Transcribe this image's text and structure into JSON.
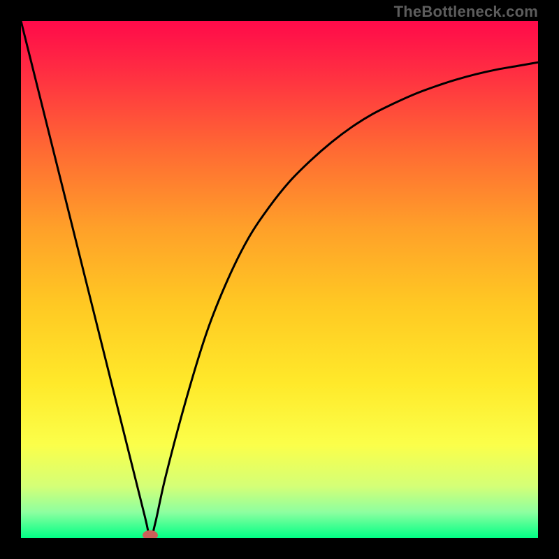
{
  "watermark": "TheBottleneck.com",
  "chart_data": {
    "type": "line",
    "title": "",
    "xlabel": "",
    "ylabel": "",
    "xlim": [
      0,
      100
    ],
    "ylim": [
      0,
      100
    ],
    "grid": false,
    "legend": false,
    "series": [
      {
        "name": "bottleneck-curve",
        "x": [
          0,
          4,
          8,
          12,
          16,
          20,
          24,
          25,
          26,
          28,
          32,
          36,
          40,
          44,
          48,
          52,
          56,
          60,
          64,
          68,
          72,
          76,
          80,
          84,
          88,
          92,
          96,
          100
        ],
        "y": [
          100,
          84,
          68,
          52,
          36,
          20,
          4,
          0,
          3,
          12,
          27,
          40,
          50,
          58,
          64,
          69,
          73,
          76.5,
          79.5,
          82,
          84,
          85.8,
          87.3,
          88.6,
          89.7,
          90.6,
          91.3,
          92
        ]
      }
    ],
    "marker": {
      "x": 25,
      "y": 0,
      "color": "#cb5f59"
    },
    "background_gradient": {
      "stops": [
        {
          "offset": 0.0,
          "color": "#ff0a4a"
        },
        {
          "offset": 0.1,
          "color": "#ff2e42"
        },
        {
          "offset": 0.25,
          "color": "#ff6a33"
        },
        {
          "offset": 0.4,
          "color": "#ffa029"
        },
        {
          "offset": 0.55,
          "color": "#ffc923"
        },
        {
          "offset": 0.7,
          "color": "#ffe92a"
        },
        {
          "offset": 0.82,
          "color": "#fbff4a"
        },
        {
          "offset": 0.9,
          "color": "#d4ff77"
        },
        {
          "offset": 0.95,
          "color": "#8dffa0"
        },
        {
          "offset": 1.0,
          "color": "#00ff85"
        }
      ]
    }
  }
}
